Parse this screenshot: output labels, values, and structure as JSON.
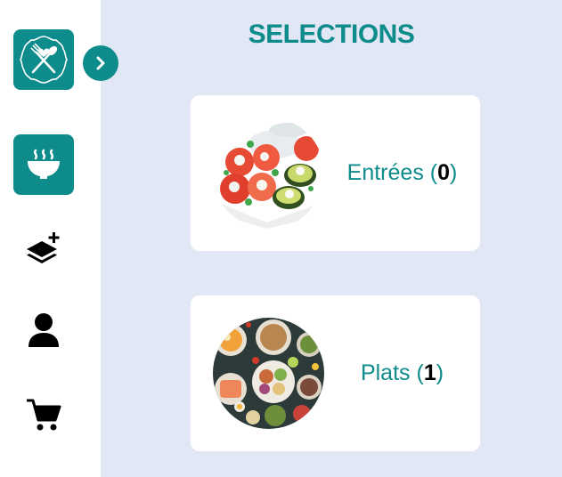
{
  "header": {
    "title": "SELECTIONS"
  },
  "sidebar": {
    "logo_icon": "fork-spoon-heart-icon",
    "expand_icon": "chevron-right-icon",
    "items": [
      {
        "icon": "soup-bowl-icon",
        "active": true
      },
      {
        "icon": "layers-add-icon",
        "active": false
      },
      {
        "icon": "user-icon",
        "active": false
      },
      {
        "icon": "cart-icon",
        "active": false
      }
    ]
  },
  "cards": [
    {
      "label": "Entrées",
      "open": "(",
      "count": "0",
      "close": ")",
      "image": "tomato-avocado-salad-photo"
    },
    {
      "label": "Plats",
      "open": "(",
      "count": "1",
      "close": ")",
      "image": "buddha-bowl-spread-photo"
    }
  ],
  "colors": {
    "accent": "#0e8b8b",
    "background": "#e2e7f6",
    "sidebar": "#ffffff"
  }
}
